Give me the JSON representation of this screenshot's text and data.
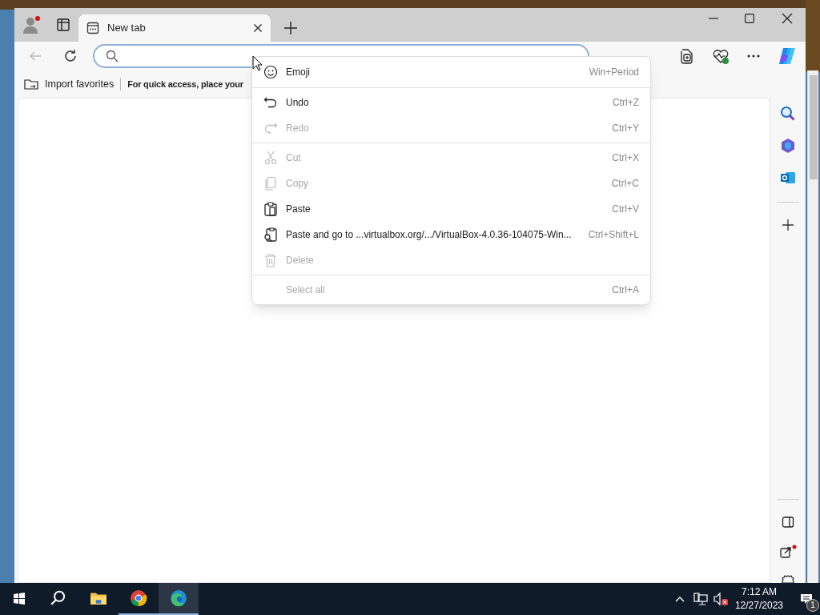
{
  "tab": {
    "title": "New tab",
    "selected": true
  },
  "favorites_bar": {
    "import": "Import favorites",
    "hint": "For quick access, place your"
  },
  "context_menu": [
    {
      "kind": "item",
      "label": "Emoji",
      "shortcut": "Win+Period",
      "disabled": false
    },
    {
      "kind": "separator"
    },
    {
      "kind": "item",
      "label": "Undo",
      "shortcut": "Ctrl+Z",
      "disabled": false
    },
    {
      "kind": "item",
      "label": "Redo",
      "shortcut": "Ctrl+Y",
      "disabled": true
    },
    {
      "kind": "separator"
    },
    {
      "kind": "item",
      "label": "Cut",
      "shortcut": "Ctrl+X",
      "disabled": true
    },
    {
      "kind": "item",
      "label": "Copy",
      "shortcut": "Ctrl+C",
      "disabled": true
    },
    {
      "kind": "item",
      "label": "Paste",
      "shortcut": "Ctrl+V",
      "disabled": false
    },
    {
      "kind": "item",
      "label": "Paste and go to ...virtualbox.org/.../VirtualBox-4.0.36-104075-Win...",
      "shortcut": "Ctrl+Shift+L",
      "disabled": false
    },
    {
      "kind": "item",
      "label": "Delete",
      "disabled": true
    },
    {
      "kind": "separator"
    },
    {
      "kind": "item",
      "label": "Select all",
      "shortcut": "Ctrl+A",
      "disabled": true
    }
  ],
  "taskbar": {
    "apps": [
      {
        "selected": false
      },
      {
        "selected": false
      },
      {
        "selected": false
      },
      {
        "selected": true
      }
    ],
    "time": "7:12 AM",
    "date": "12/27/2023",
    "notifications": "1"
  }
}
